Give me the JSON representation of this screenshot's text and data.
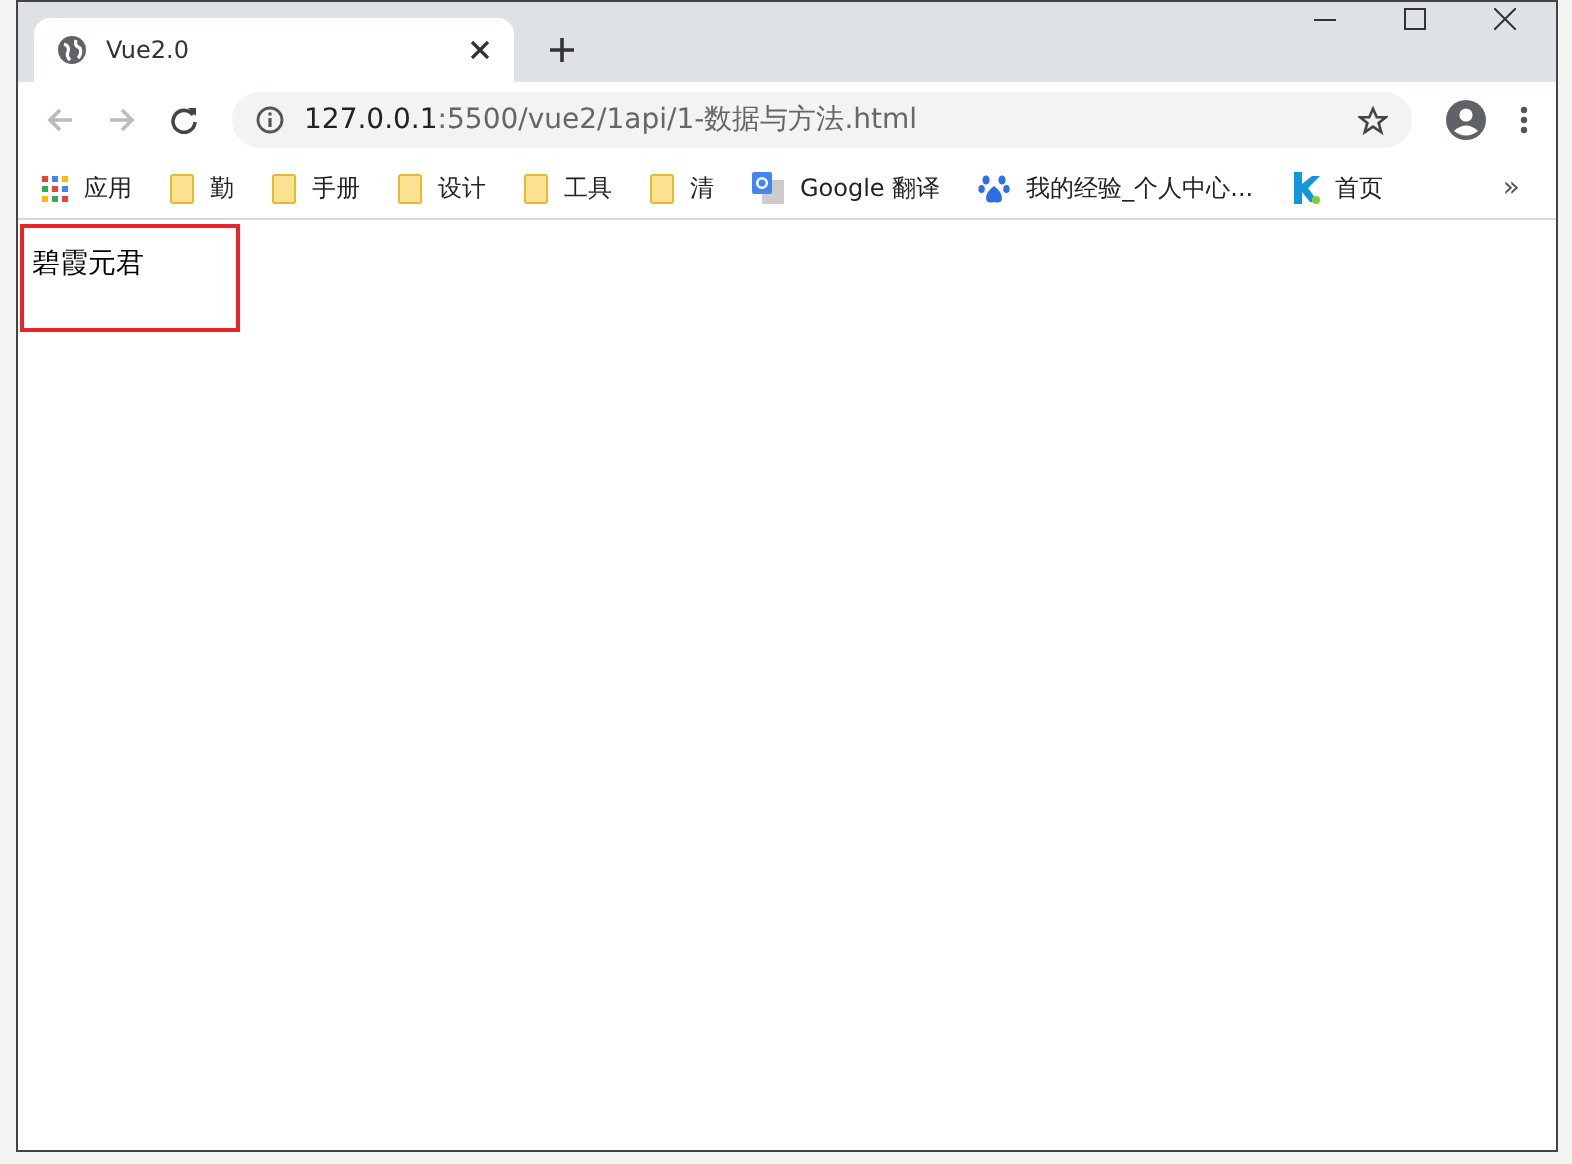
{
  "tab": {
    "title": "Vue2.0",
    "selected": true
  },
  "address_bar": {
    "url_host": "127.0.0.1",
    "url_rest": ":5500/vue2/1api/1-数据与方法.html"
  },
  "bookmarks": [
    {
      "kind": "apps",
      "label": "应用"
    },
    {
      "kind": "folder",
      "label": "勤"
    },
    {
      "kind": "folder",
      "label": "手册"
    },
    {
      "kind": "folder",
      "label": "设计"
    },
    {
      "kind": "folder",
      "label": "工具"
    },
    {
      "kind": "folder",
      "label": "清"
    },
    {
      "kind": "translate",
      "label": "Google 翻译"
    },
    {
      "kind": "paw",
      "label": "我的经验_个人中心..."
    },
    {
      "kind": "k",
      "label": "首页"
    }
  ],
  "bookmarks_more": "»",
  "page": {
    "text": "碧霞元君",
    "highlighted": true
  }
}
